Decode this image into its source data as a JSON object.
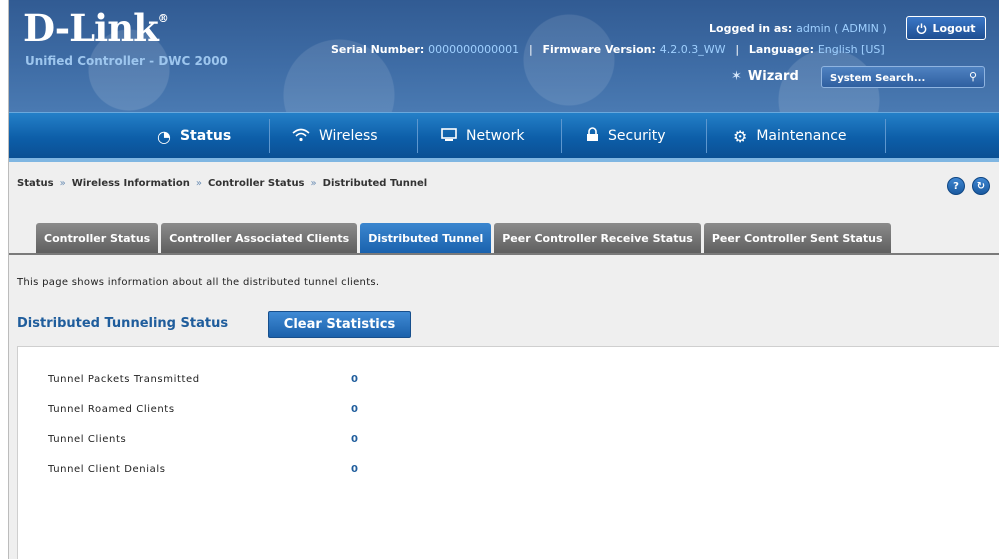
{
  "header": {
    "logo": "D-Link",
    "logo_mark": "®",
    "product": "Unified Controller - DWC 2000",
    "serial_label": "Serial Number:",
    "serial_value": "0000000000001",
    "firmware_label": "Firmware Version:",
    "firmware_value": "4.2.0.3_WW",
    "language_label": "Language:",
    "language_value": "English [US]",
    "logged_in_label": "Logged in as:",
    "logged_in_value": "admin ( ADMIN )",
    "logout_label": "Logout",
    "wizard_label": "Wizard",
    "search_placeholder": "System Search..."
  },
  "nav": {
    "items": [
      {
        "label": "Status",
        "icon": "dashboard-icon",
        "active": true
      },
      {
        "label": "Wireless",
        "icon": "wifi-icon"
      },
      {
        "label": "Network",
        "icon": "monitor-icon"
      },
      {
        "label": "Security",
        "icon": "lock-icon"
      },
      {
        "label": "Maintenance",
        "icon": "gears-icon"
      }
    ]
  },
  "breadcrumb": [
    "Status",
    "Wireless Information",
    "Controller Status",
    "Distributed Tunnel"
  ],
  "tabs": [
    {
      "label": "Controller Status"
    },
    {
      "label": "Controller Associated Clients"
    },
    {
      "label": "Distributed Tunnel",
      "active": true
    },
    {
      "label": "Peer Controller Receive Status"
    },
    {
      "label": "Peer Controller Sent Status"
    }
  ],
  "intro": "This page shows information about all the distributed tunnel clients.",
  "section": {
    "title": "Distributed Tunneling Status",
    "clear_button": "Clear Statistics"
  },
  "stats": [
    {
      "label": "Tunnel Packets Transmitted",
      "value": "0"
    },
    {
      "label": "Tunnel Roamed Clients",
      "value": "0"
    },
    {
      "label": "Tunnel Clients",
      "value": "0"
    },
    {
      "label": "Tunnel Client Denials",
      "value": "0"
    }
  ]
}
